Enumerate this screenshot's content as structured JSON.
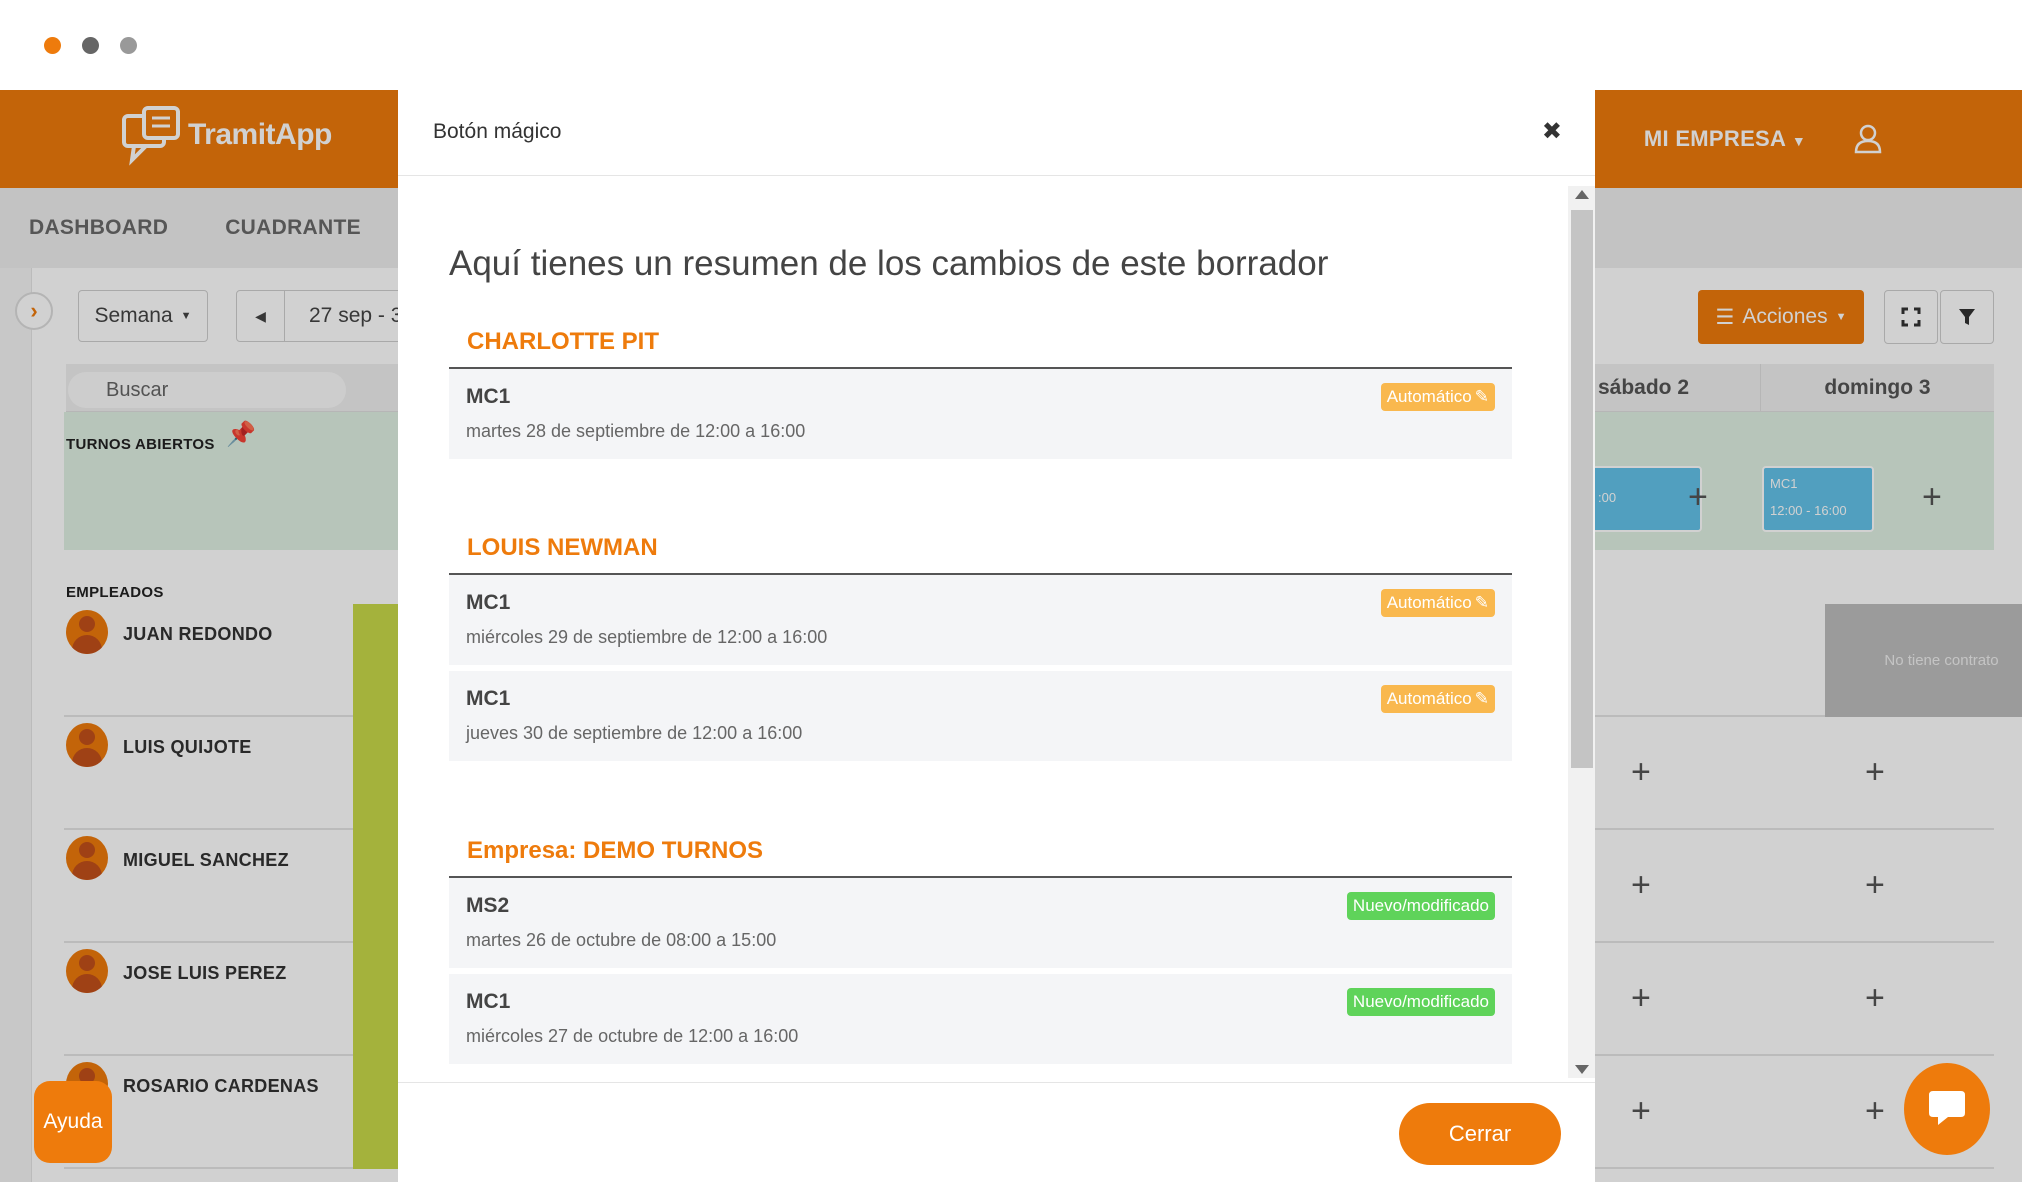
{
  "window": {
    "dots": [
      "#ee7b0c",
      "#666666",
      "#999999"
    ]
  },
  "header": {
    "logo_text": "TramitApp",
    "company_label": "MI EMPRESA",
    "refresh_icon": "refresh-icon",
    "user_icon": "user-icon"
  },
  "nav": {
    "items": [
      "DASHBOARD",
      "CUADRANTE"
    ]
  },
  "toolbar": {
    "week_label": "Semana",
    "date_range": "27 sep - 3",
    "actions_label": "Acciones"
  },
  "grid": {
    "search_placeholder": "Buscar",
    "days": [
      "sábado 2",
      "domingo 3"
    ],
    "open_shifts_label": "TURNOS ABIERTOS",
    "employees_label": "EMPLEADOS",
    "open_cards": [
      {
        "code": "",
        "time": ":00"
      },
      {
        "code": "MC1",
        "time": "12:00 - 16:00"
      }
    ],
    "employees": [
      "JUAN REDONDO",
      "LUIS QUIJOTE",
      "MIGUEL SANCHEZ",
      "JOSE LUIS PEREZ",
      "ROSARIO CARDENAS"
    ],
    "no_contract_text": "No tiene contrato"
  },
  "help_label": "Ayuda",
  "colors": {
    "brand_orange": "#ee7b0c",
    "auto_badge": "#f9b84e",
    "new_badge": "#5fd35a"
  },
  "modal": {
    "title": "Botón mágico",
    "summary_title": "Aquí tienes un resumen de los cambios de este borrador",
    "sections": [
      {
        "heading": "CHARLOTTE PIT",
        "items": [
          {
            "code": "MC1",
            "when": "martes 28 de septiembre de 12:00 a 16:00",
            "badge": "Automático"
          }
        ]
      },
      {
        "heading": "LOUIS NEWMAN",
        "items": [
          {
            "code": "MC1",
            "when": "miércoles 29 de septiembre de 12:00 a 16:00",
            "badge": "Automático"
          },
          {
            "code": "MC1",
            "when": "jueves 30 de septiembre de 12:00 a 16:00",
            "badge": "Automático"
          }
        ]
      },
      {
        "heading": "Empresa: DEMO TURNOS",
        "items": [
          {
            "code": "MS2",
            "when": "martes 26 de octubre de 08:00 a 15:00",
            "badge": "Nuevo/modificado"
          },
          {
            "code": "MC1",
            "when": "miércoles 27 de octubre de 12:00 a 16:00",
            "badge": "Nuevo/modificado"
          }
        ]
      }
    ],
    "close_button": "Cerrar"
  }
}
